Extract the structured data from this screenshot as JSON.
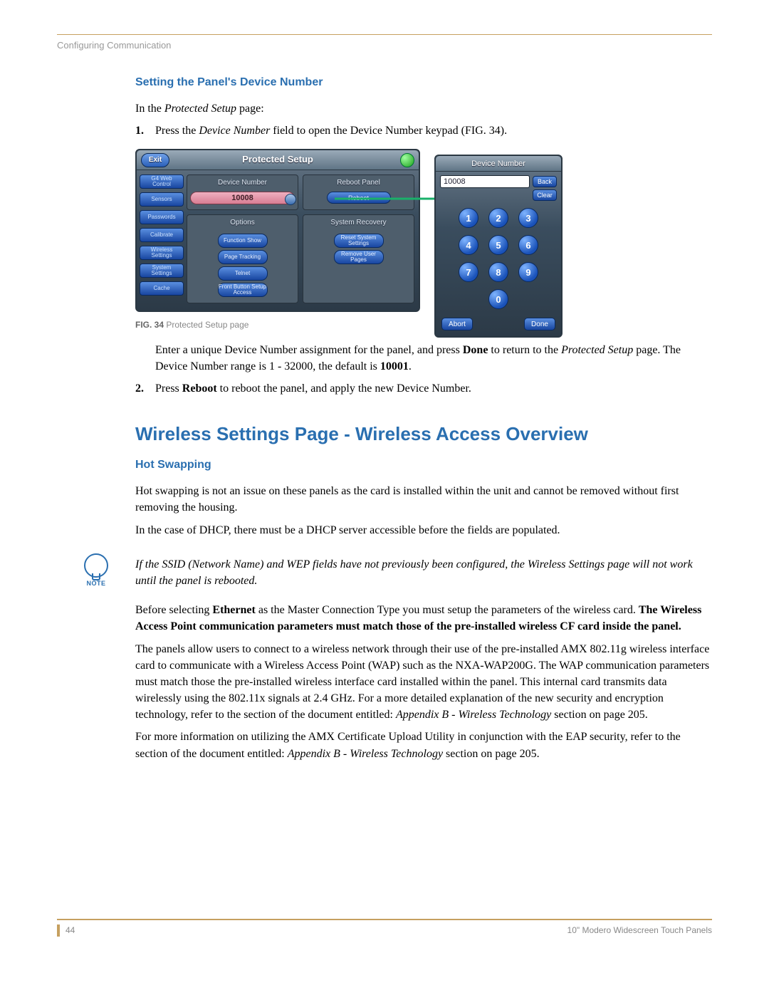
{
  "header": {
    "section": "Configuring Communication"
  },
  "headings": {
    "h3a": "Setting the Panel's Device Number",
    "h2a": "Wireless Settings Page - Wireless Access Overview",
    "h3b": "Hot Swapping"
  },
  "intro": {
    "prefix": "In the ",
    "emph": "Protected Setup",
    "suffix": " page:"
  },
  "steps": {
    "s1_num": "1.",
    "s1_a": "Press the ",
    "s1_b": "Device Number",
    "s1_c": " field to open the Device Number keypad (FIG. 34).",
    "s1_follow_a": "Enter a unique Device Number assignment for the panel, and press ",
    "s1_follow_b": "Done",
    "s1_follow_c": " to return to the ",
    "s1_follow_d": "Protected Setup",
    "s1_follow_e": " page. The Device Number range is 1 - 32000, the default is ",
    "s1_follow_f": "10001",
    "s1_follow_g": ".",
    "s2_num": "2.",
    "s2_a": "Press ",
    "s2_b": "Reboot",
    "s2_c": " to reboot the panel, and apply the new Device Number."
  },
  "fig": {
    "label_bold": "FIG. 34",
    "label_rest": "  Protected Setup page",
    "titlebar": "Protected Setup",
    "exit": "Exit",
    "device_number_group": "Device Number",
    "device_number_value": "10008",
    "reboot_group": "Reboot Panel",
    "reboot_btn": "Reboot",
    "options_group": "Options",
    "opts": [
      "Function Show",
      "Page Tracking",
      "Telnet",
      "Front Button Setup Access"
    ],
    "recovery_group": "System Recovery",
    "recovery_btns": [
      "Reset System Settings",
      "Remove User Pages"
    ],
    "side": [
      "G4 Web Control",
      "Sensors",
      "Passwords",
      "Calibrate",
      "Wireless Settings",
      "System Settings",
      "Cache"
    ],
    "keypad": {
      "title": "Device Number",
      "display": "10008",
      "back": "Back",
      "clear": "Clear",
      "keys": [
        "1",
        "2",
        "3",
        "4",
        "5",
        "6",
        "7",
        "8",
        "9",
        "0"
      ],
      "abort": "Abort",
      "done": "Done"
    }
  },
  "body": {
    "p1": "Hot swapping is not an issue on these panels as the card is installed within the unit and cannot be removed without first removing the housing.",
    "p2": "In the case of DHCP, there must be a DHCP server accessible before the fields are populated.",
    "note": "If the SSID (Network Name) and WEP fields have not previously been configured, the Wireless Settings page will not work until the panel is rebooted.",
    "p3_a": "Before selecting ",
    "p3_b": "Ethernet",
    "p3_c": " as the Master Connection Type you must setup the parameters of the wireless card. ",
    "p3_d": "The Wireless Access Point communication parameters must match those of the pre-installed wireless CF card inside the panel.",
    "p4_a": "The panels allow users to connect to a wireless network through their use of the pre-installed AMX 802.11g wireless interface card to communicate with a Wireless Access Point (WAP) such as the NXA-WAP200G. The WAP communication parameters must match those the pre-installed wireless interface card installed within the panel. This internal card transmits data wirelessly using the 802.11x signals at 2.4 GHz. For a more detailed explanation of the new security and encryption technology, refer to the section of the document entitled: ",
    "p4_b": "Appendix B - Wireless Technology",
    "p4_c": " section on page 205.",
    "p5_a": "For more information on utilizing the AMX Certificate Upload Utility in conjunction with the EAP security, refer to the section of the document entitled: ",
    "p5_b": "Appendix B - Wireless Technology",
    "p5_c": " section on page 205."
  },
  "note_label": "NOTE",
  "footer": {
    "page": "44",
    "doc": "10\" Modero Widescreen Touch Panels"
  }
}
